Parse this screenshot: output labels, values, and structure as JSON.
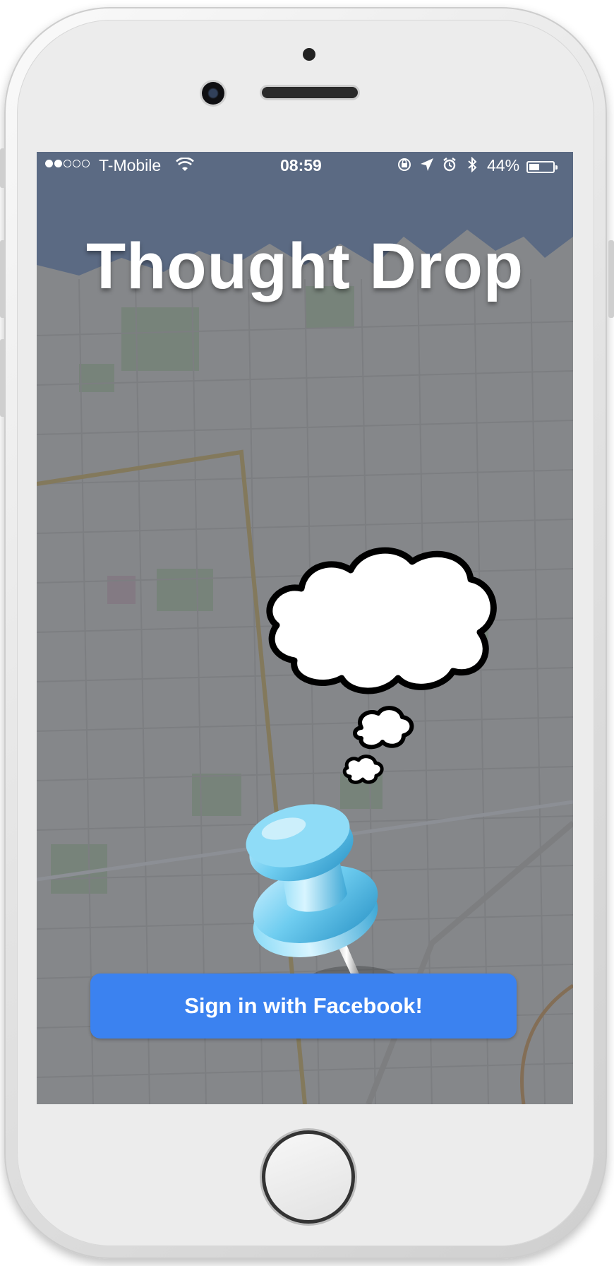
{
  "status_bar": {
    "signal_bars_filled": 2,
    "signal_bars_total": 5,
    "carrier": "T-Mobile",
    "time": "08:59",
    "battery_percent": "44%",
    "battery_level": 0.44,
    "icons": [
      "orientation-lock-icon",
      "location-arrow-icon",
      "alarm-icon",
      "bluetooth-icon"
    ]
  },
  "app": {
    "title": "Thought Drop"
  },
  "illustration": {
    "icons": [
      "thought-bubble-icon",
      "pushpin-icon"
    ]
  },
  "actions": {
    "facebook_signin_label": "Sign in with Facebook!"
  },
  "colors": {
    "button": "#3b82f0",
    "pin": "#6fcdf0"
  }
}
